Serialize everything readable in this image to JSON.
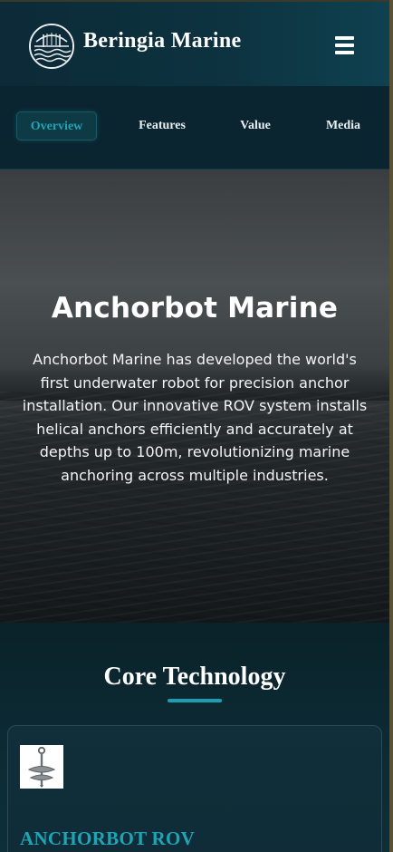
{
  "header": {
    "brand": "Beringia Marine",
    "logo_icon": "bridge-waves-logo-icon",
    "menu_icon": "hamburger-menu-icon"
  },
  "tabs": [
    {
      "label": "Overview",
      "active": true
    },
    {
      "label": "Features",
      "active": false
    },
    {
      "label": "Value",
      "active": false
    },
    {
      "label": "Media",
      "active": false
    }
  ],
  "hero": {
    "title": "Anchorbot Marine",
    "description": "Anchorbot Marine has developed the world's first underwater robot for precision anchor installation. Our innovative ROV system installs helical anchors efficiently and accurately at depths up to 100m, revolutionizing marine anchoring across multiple industries."
  },
  "core": {
    "title": "Core Technology",
    "card": {
      "thumb_icon": "helical-anchor-icon",
      "title": "ANCHORBOT ROV"
    }
  },
  "colors": {
    "accent": "#1da5b5",
    "header_bg": "#0c2a37",
    "page_bg": "#0a2530"
  }
}
